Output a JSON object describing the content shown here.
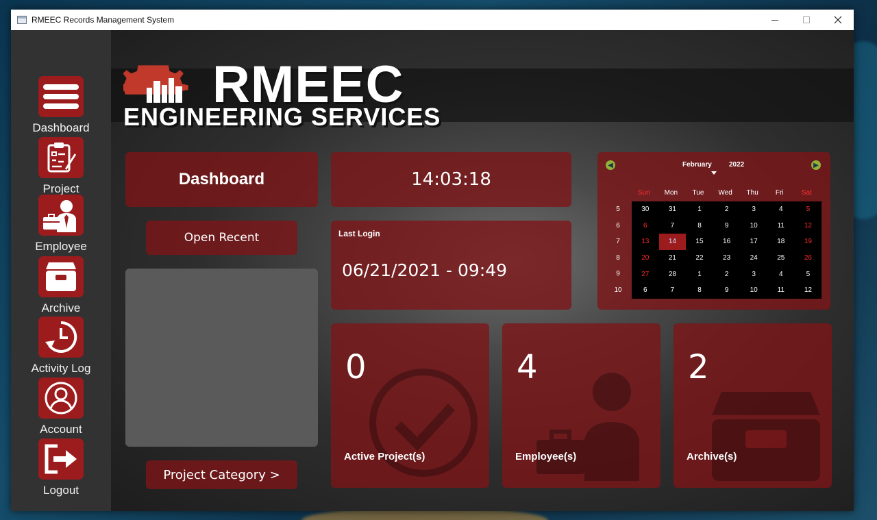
{
  "window": {
    "title": "RMEEC Records Management System",
    "controls": {
      "minimize": "—",
      "maximize": "☐",
      "close": "✕"
    }
  },
  "sidebar": {
    "items": [
      {
        "label": "Dashboard",
        "icon": "menu-icon"
      },
      {
        "label": "Project",
        "icon": "clipboard-icon"
      },
      {
        "label": "Employee",
        "icon": "employee-icon"
      },
      {
        "label": "Archive",
        "icon": "archive-box-icon"
      },
      {
        "label": "Activity Log",
        "icon": "clock-history-icon"
      },
      {
        "label": "Account",
        "icon": "user-circle-icon"
      },
      {
        "label": "Logout",
        "icon": "logout-icon"
      }
    ]
  },
  "logo": {
    "main": "RMEEC",
    "sub": "ENGINEERING SERVICES"
  },
  "main": {
    "page_title": "Dashboard",
    "clock": "14:03:18",
    "open_recent": "Open Recent",
    "project_category": "Project Category   >",
    "last_login": {
      "label": "Last Login",
      "value": "06/21/2021 - 09:49"
    }
  },
  "calendar": {
    "month": "February",
    "year": "2022",
    "days_of_week": [
      "Sun",
      "Mon",
      "Tue",
      "Wed",
      "Thu",
      "Fri",
      "Sat"
    ],
    "weeks": [
      {
        "num": "5",
        "days": [
          "30",
          "31",
          "1",
          "2",
          "3",
          "4",
          "5"
        ]
      },
      {
        "num": "6",
        "days": [
          "6",
          "7",
          "8",
          "9",
          "10",
          "11",
          "12"
        ]
      },
      {
        "num": "7",
        "days": [
          "13",
          "14",
          "15",
          "16",
          "17",
          "18",
          "19"
        ]
      },
      {
        "num": "8",
        "days": [
          "20",
          "21",
          "22",
          "23",
          "24",
          "25",
          "26"
        ]
      },
      {
        "num": "9",
        "days": [
          "27",
          "28",
          "1",
          "2",
          "3",
          "4",
          "5"
        ]
      },
      {
        "num": "10",
        "days": [
          "6",
          "7",
          "8",
          "9",
          "10",
          "11",
          "12"
        ]
      }
    ],
    "selected": "14",
    "weekend_color": "#ff2a2a",
    "selected_color": "#9c1c1e"
  },
  "stats": [
    {
      "value": "0",
      "label": "Active Project(s)",
      "icon": "check-circle-icon"
    },
    {
      "value": "4",
      "label": "Employee(s)",
      "icon": "employee-icon"
    },
    {
      "value": "2",
      "label": "Archive(s)",
      "icon": "archive-box-icon"
    }
  ],
  "colors": {
    "accent": "#9c1c1e",
    "sidebar": "#323232",
    "panel": "#7d1417"
  }
}
